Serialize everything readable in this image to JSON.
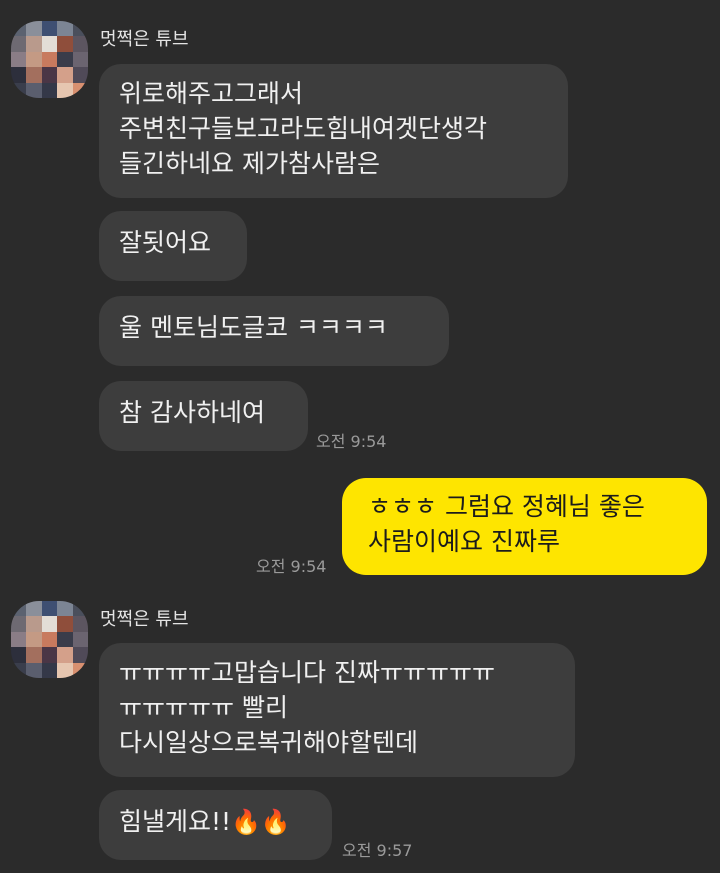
{
  "groups": [
    {
      "sender": "멋쩍은 튜브",
      "messages": [
        {
          "text": "위로해주고그래서\n주변친구들보고라도힘내여겟단생각\n들긴하네요 제가참사람은"
        },
        {
          "text": "잘됫어요"
        },
        {
          "text": "울 멘토님도글코 ㅋㅋㅋㅋ"
        },
        {
          "text": "참 감사하네여",
          "time": "오전 9:54"
        }
      ]
    },
    {
      "sender": "멋쩍은 튜브",
      "messages": [
        {
          "text": "ㅠㅠㅠㅠ고맙습니다 진짜ㅠㅠㅠㅠㅠ\nㅠㅠㅠㅠㅠ 빨리\n다시일상으로복귀해야할텐데"
        },
        {
          "text": "힘낼게요!!",
          "emoji": "🔥🔥",
          "time": "오전 9:57"
        }
      ]
    }
  ],
  "my_message": {
    "text": "ㅎㅎㅎ 그럼요 정혜님 좋은\n사람이예요 진짜루",
    "time": "오전 9:54"
  },
  "colors": {
    "background": "#2b2b2b",
    "incoming_bubble": "#3d3d3d",
    "outgoing_bubble": "#fee500",
    "timestamp": "#9a9a9a"
  }
}
